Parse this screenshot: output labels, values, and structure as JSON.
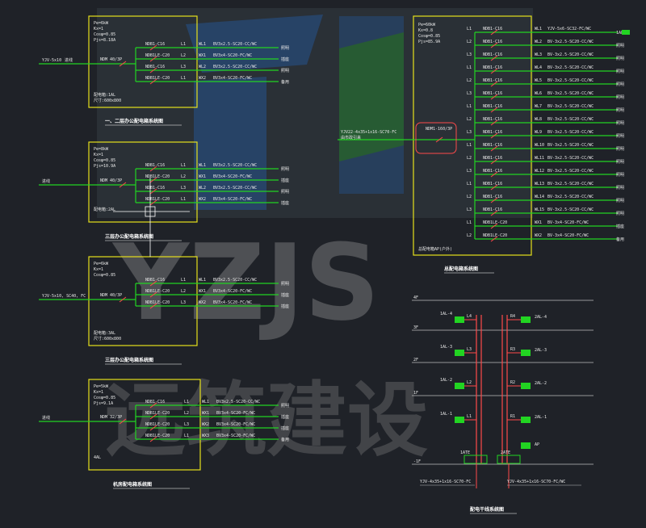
{
  "watermark": {
    "brand_latin": "YZJS",
    "brand_cn": "远筑建设"
  },
  "colors": {
    "background": "#1f2228",
    "box": "#e6e01c",
    "wire": "#22d422",
    "breaker": "#ff4a4a",
    "text": "#e8e8e8",
    "watermark_blue": "#2e5f9a",
    "watermark_green": "#2f8a3c",
    "watermark_grey": "#9a9a9a"
  },
  "panels": [
    {
      "id": "panel-1",
      "title": "一、二层办公配电箱系统图",
      "box_text": [
        "Pe=6kW",
        "Kx=1",
        "Cosφ=0.85",
        "Pjs=8.18A"
      ],
      "box_foot": [
        "配电箱:1AL",
        "尺寸:600x800"
      ],
      "incoming": "YJV-5x10",
      "incoming_tag": "进线",
      "main_breaker": "NDM 40/3P",
      "circuits": [
        {
          "breaker": "NDB1-C16",
          "phase": "L1",
          "id": "WL1",
          "cable": "BV3x2.5-SC20-CC/WC",
          "load": "照明"
        },
        {
          "breaker": "NDB1LE-C20",
          "phase": "L2",
          "id": "WX1",
          "cable": "BV3x4-SC20-FC/WC",
          "load": "插座"
        },
        {
          "breaker": "NDB1-C16",
          "phase": "L3",
          "id": "WL2",
          "cable": "BV3x2.5-SC20-CC/WC",
          "load": "照明"
        },
        {
          "breaker": "NDB1LE-C20",
          "phase": "L1",
          "id": "WX2",
          "cable": "BV3x4-SC20-FC/WC",
          "load": "备用"
        }
      ]
    },
    {
      "id": "panel-2",
      "title": "三层办公配电箱系统图",
      "box_text": [
        "Pe=8kW",
        "Kx=1",
        "Cosφ=0.85",
        "Pjs=10.9A"
      ],
      "box_foot": [
        "配电箱:2AL"
      ],
      "incoming": "进线",
      "main_breaker": "NDM 40/3P",
      "circuits": [
        {
          "breaker": "NDB1-C16",
          "phase": "L1",
          "id": "WL1",
          "cable": "BV3x2.5-SC20-CC/WC",
          "load": "照明"
        },
        {
          "breaker": "NDB1LE-C20",
          "phase": "L2",
          "id": "WX1",
          "cable": "BV3x4-SC20-FC/WC",
          "load": "插座"
        },
        {
          "breaker": "NDB1-C16",
          "phase": "L3",
          "id": "WL2",
          "cable": "BV3x2.5-SC20-CC/WC",
          "load": "照明"
        },
        {
          "breaker": "NDB1LE-C20",
          "phase": "L1",
          "id": "WX2",
          "cable": "BV3x4-SC20-FC/WC",
          "load": "插座"
        }
      ]
    },
    {
      "id": "panel-3",
      "title": "三层办公配电箱系统图",
      "box_text": [
        "Pe=6kW",
        "Kx=1",
        "Cosφ=0.85"
      ],
      "box_foot": [
        "配电箱:3AL",
        "尺寸:600x800"
      ],
      "incoming": "YJV-5x10, SC40, FC",
      "main_breaker": "NDM 40/3P",
      "circuits": [
        {
          "breaker": "NDB1-C16",
          "phase": "L1",
          "id": "WL1",
          "cable": "BV3x2.5-SC20-CC/WC",
          "load": "照明"
        },
        {
          "breaker": "NDB1LE-C20",
          "phase": "L2",
          "id": "WX1",
          "cable": "BV3x4-SC20-FC/WC",
          "load": "插座"
        },
        {
          "breaker": "NDB1LE-C20",
          "phase": "L3",
          "id": "WX2",
          "cable": "BV3x4-SC20-FC/WC",
          "load": "插座"
        }
      ]
    },
    {
      "id": "panel-4",
      "title": "机房配电箱系统图",
      "box_text": [
        "Pe=5kW",
        "Kx=1",
        "Cosφ=0.85",
        "Pjs=9.1A"
      ],
      "box_foot": [
        "4AL"
      ],
      "incoming": "进线",
      "main_breaker": "NDM 32/3P",
      "circuits": [
        {
          "breaker": "NDB1-C16",
          "phase": "L1",
          "id": "WL1",
          "cable": "BV3x2.5-SC20-CC/WC",
          "load": "照明"
        },
        {
          "breaker": "NDB1LE-C20",
          "phase": "L2",
          "id": "WX1",
          "cable": "BV3x4-SC20-FC/WC",
          "load": "插座"
        },
        {
          "breaker": "NDB1LE-C20",
          "phase": "L3",
          "id": "WX2",
          "cable": "BV3x4-SC20-FC/WC",
          "load": "插座"
        },
        {
          "breaker": "NDB1LE-C20",
          "phase": "L1",
          "id": "WX3",
          "cable": "BV3x4-SC20-FC/WC",
          "load": "备用"
        }
      ]
    }
  ],
  "big_panel": {
    "title": "总配电箱系统图",
    "box_text": [
      "Pe=60kW",
      "Kx=0.8",
      "Cosφ=0.85",
      "Pjs=85.9A"
    ],
    "box_foot": "总配电箱AP(户外)",
    "incoming": "YJV22-4x35+1x16-SC70-FC",
    "incoming_tag": "由市政引来",
    "main_breaker": "NDM1-160/3P",
    "phases": [
      "L1",
      "L2",
      "L3",
      "L1",
      "L2",
      "L3",
      "L1",
      "L2",
      "L3",
      "L1",
      "L2",
      "L3",
      "L1",
      "L2",
      "L3",
      "L1",
      "L2"
    ],
    "breakers": [
      "NDB1-C16",
      "NDB1-C16",
      "NDB1-C16",
      "NDB1-C16",
      "NDB1-C16",
      "NDB1-C16",
      "NDB1-C16",
      "NDB1-C16",
      "NDB1-C16",
      "NDB1-C16",
      "NDB1-C16",
      "NDB1-C16",
      "NDB1-C16",
      "NDB1-C16",
      "NDB1-C16",
      "NDB1LE-C20",
      "NDB1LE-C20"
    ],
    "ids": [
      "WL1",
      "WL2",
      "WL3",
      "WL4",
      "WL5",
      "WL6",
      "WL7",
      "WL8",
      "WL9",
      "WL10",
      "WL11",
      "WL12",
      "WL13",
      "WL14",
      "WL15",
      "WX1",
      "WX2"
    ],
    "cables": [
      "YJV-5x6-SC32-FC/WC",
      "BV-3x2.5-SC20-CC/WC",
      "BV-3x2.5-SC20-CC/WC",
      "BV-3x2.5-SC20-CC/WC",
      "BV-3x2.5-SC20-CC/WC",
      "BV-3x2.5-SC20-CC/WC",
      "BV-3x2.5-SC20-CC/WC",
      "BV-3x2.5-SC20-CC/WC",
      "BV-3x2.5-SC20-CC/WC",
      "BV-3x2.5-SC20-CC/WC",
      "BV-3x2.5-SC20-CC/WC",
      "BV-3x2.5-SC20-CC/WC",
      "BV-3x2.5-SC20-CC/WC",
      "BV-3x2.5-SC20-CC/WC",
      "BV-3x2.5-SC20-CC/WC",
      "BV-3x4-SC20-FC/WC",
      "BV-3x4-SC20-FC/WC"
    ],
    "loads": [
      "1AL",
      "照明",
      "照明",
      "照明",
      "照明",
      "照明",
      "照明",
      "照明",
      "照明",
      "照明",
      "照明",
      "照明",
      "照明",
      "照明",
      "照明",
      "插座",
      "备用"
    ]
  },
  "riser": {
    "title": "配电干线系统图",
    "floors": [
      "4F",
      "3F",
      "2F",
      "1F",
      "-1F"
    ],
    "left_boxes": [
      "1AL-4",
      "1AL-3",
      "1AL-2",
      "1AL-1"
    ],
    "left_tags": [
      "L4",
      "L3",
      "L2",
      "L1"
    ],
    "right_boxes": [
      "2AL-4",
      "2AL-3",
      "2AL-2",
      "2AL-1"
    ],
    "right_tags": [
      "R4",
      "R3",
      "R2",
      "R1"
    ],
    "bottom_left_box": "1ATE",
    "bottom_right_box": "2ATE",
    "bottom_right_tag": "AP",
    "feeder_left": "YJV-4x35+1x16-SC70-FC",
    "feeder_right": "YJV-4x35+1x16-SC70-FC/WC"
  }
}
